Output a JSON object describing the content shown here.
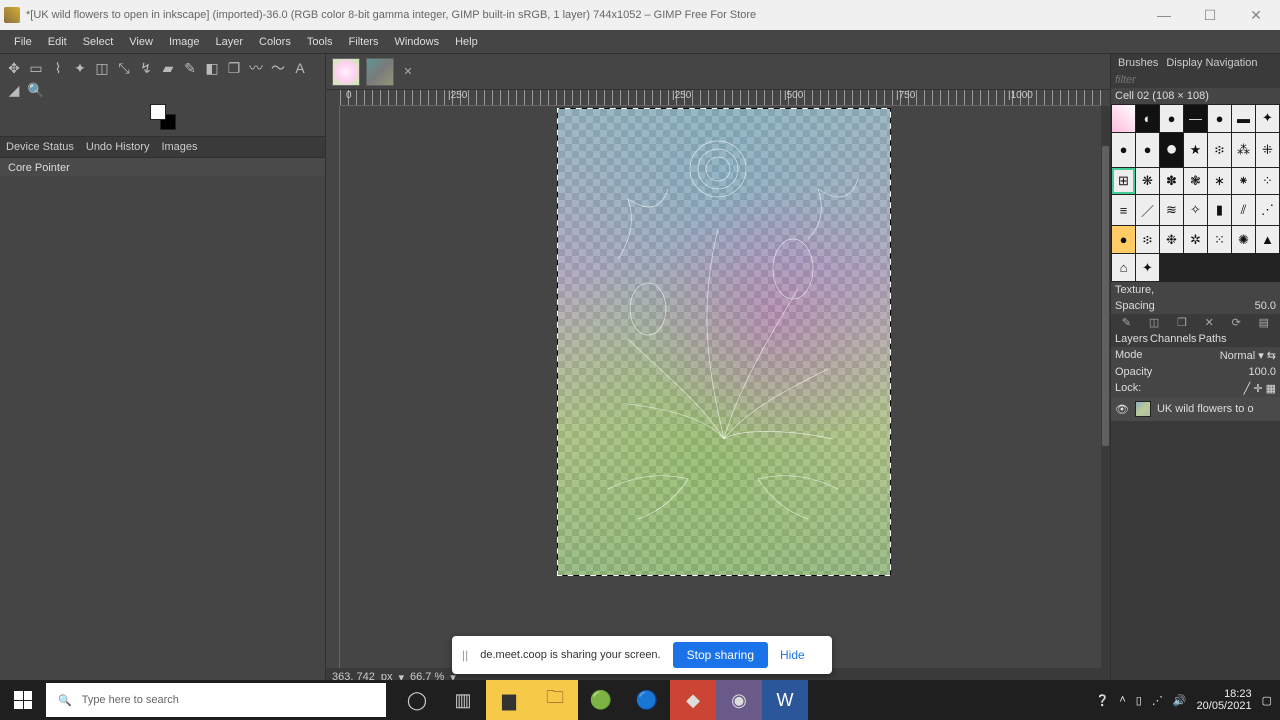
{
  "titlebar": {
    "title": "*[UK wild flowers to open in inkscape] (imported)-36.0 (RGB color 8-bit gamma integer, GIMP built-in sRGB, 1 layer) 744x1052 – GIMP Free For Store"
  },
  "menubar": [
    "File",
    "Edit",
    "Select",
    "View",
    "Image",
    "Layer",
    "Colors",
    "Tools",
    "Filters",
    "Windows",
    "Help"
  ],
  "left_tabs": [
    "Device Status",
    "Undo History",
    "Images"
  ],
  "device_item": "Core Pointer",
  "ruler_h": [
    "0",
    "|250",
    "|250",
    "|500",
    "|750",
    "|1000"
  ],
  "status": {
    "coords": "363, 742",
    "unit": "px",
    "zoom": "66.7 %"
  },
  "right": {
    "top_tabs": [
      "Brushes",
      "Display Navigation"
    ],
    "filter_placeholder": "filter",
    "cell": "Cell 02 (108 × 108)",
    "texture_label": "Texture,",
    "spacing_label": "Spacing",
    "spacing_value": "50.0",
    "layer_tabs": [
      "Layers",
      "Channels",
      "Paths"
    ],
    "mode_label": "Mode",
    "mode_value": "Normal",
    "opacity_label": "Opacity",
    "opacity_value": "100.0",
    "lock_label": "Lock:",
    "layer_name": "UK wild flowers to o"
  },
  "share": {
    "msg": "de.meet.coop is sharing your screen.",
    "stop": "Stop sharing",
    "hide": "Hide"
  },
  "taskbar": {
    "search_placeholder": "Type here to search",
    "time": "18:23",
    "date": "20/05/2021"
  }
}
